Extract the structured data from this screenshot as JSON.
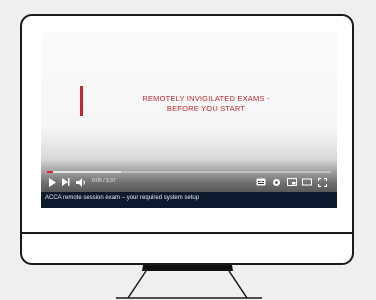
{
  "video": {
    "headline_line1": "REMOTELY INVIGILATED EXAMS -",
    "headline_line2": "BEFORE YOU START",
    "time_display": "0:05 / 3:37",
    "progress": 0.02,
    "buffered": 0.26,
    "caption": "ACCA remote session exam – your required system setup",
    "accent_color": "#c1272d",
    "progress_color": "#e0242a",
    "icons": [
      "play-icon",
      "next-icon",
      "volume-icon",
      "subtitles-icon",
      "settings-icon",
      "miniplayer-icon",
      "theater-icon",
      "fullscreen-icon"
    ]
  }
}
